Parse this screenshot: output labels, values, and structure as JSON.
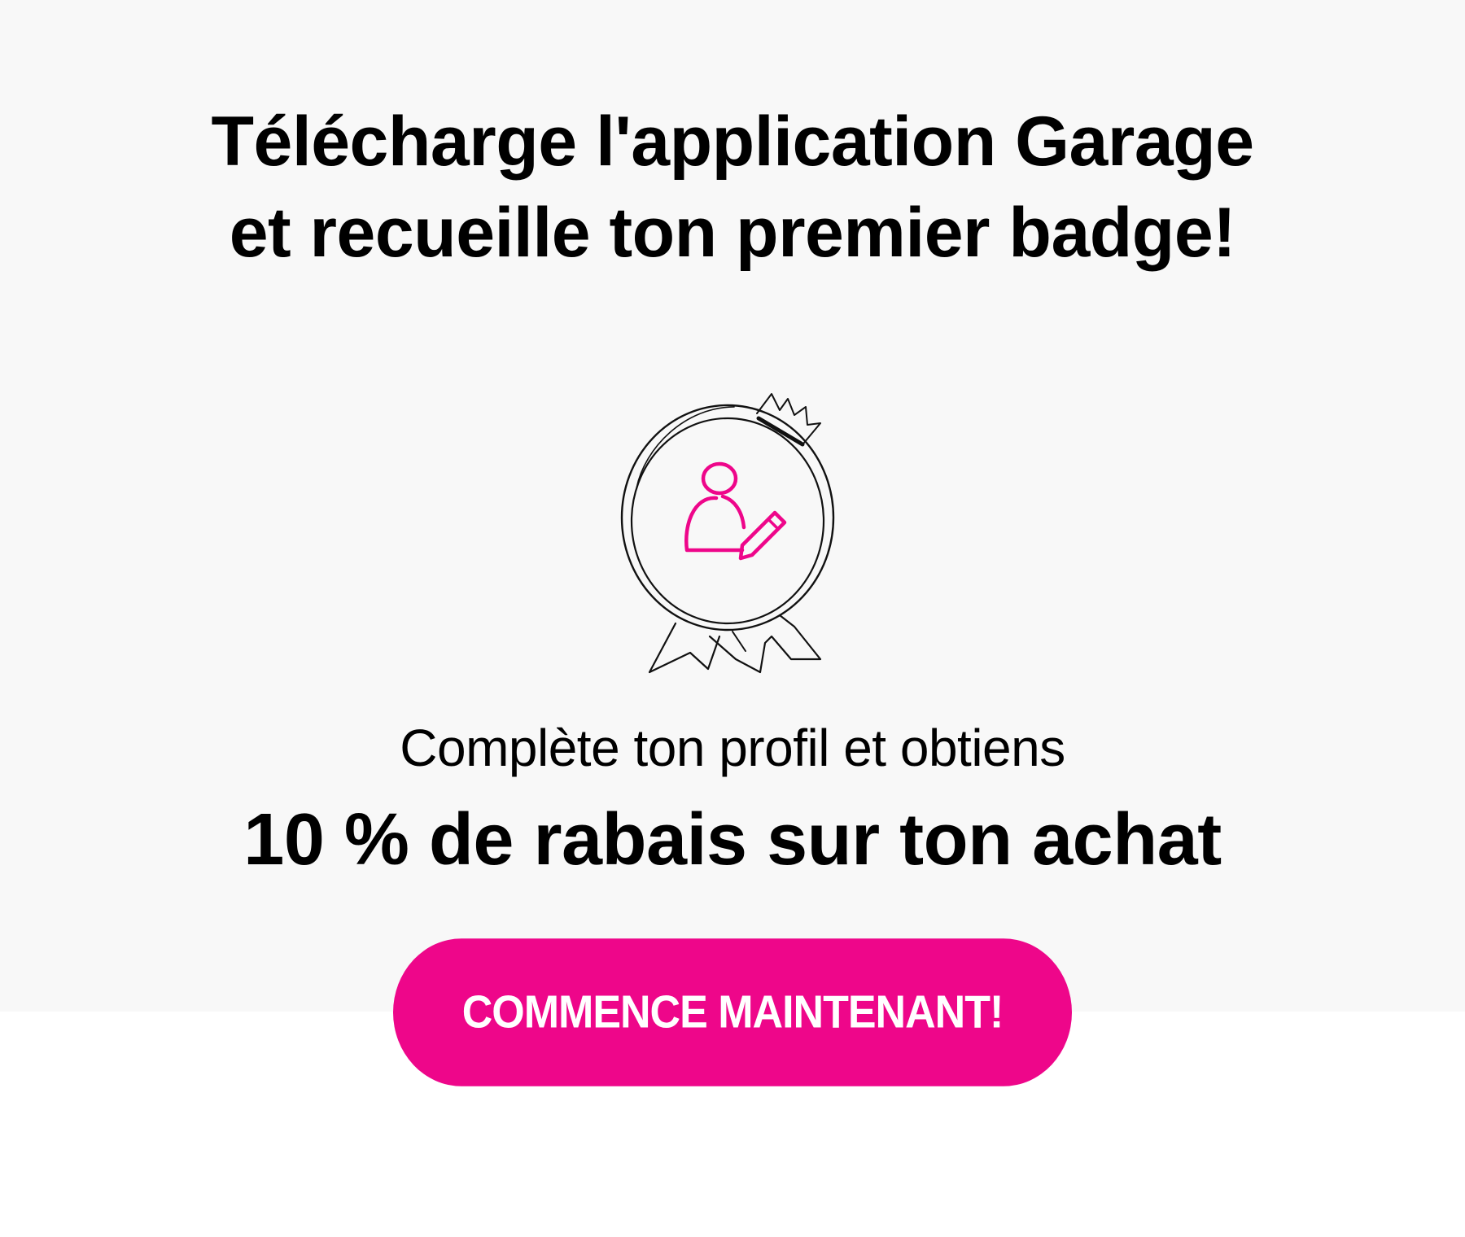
{
  "hero": {
    "headline_line1": "Télécharge l'application Garage",
    "headline_line2": "et recueille ton premier badge!",
    "background_color": "#f8f8f8"
  },
  "badge": {
    "icon": "profile-badge-icon",
    "accent_color": "#ee068a"
  },
  "promo": {
    "subtext": "Complète ton profil et obtiens",
    "offer": "10 % de rabais sur ton achat"
  },
  "cta": {
    "label": "COMMENCE MAINTENANT!",
    "color": "#ee068a"
  }
}
